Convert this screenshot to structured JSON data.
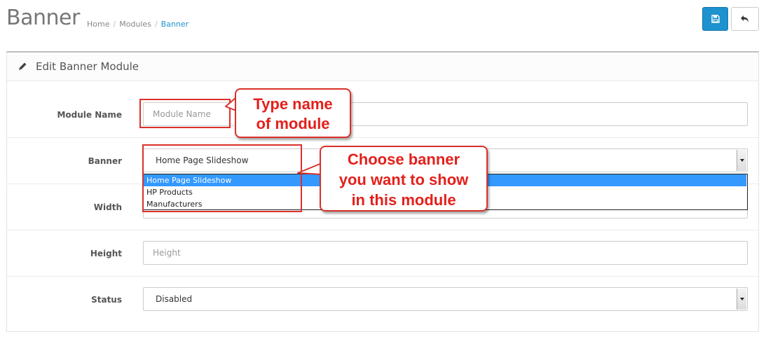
{
  "header": {
    "title": "Banner",
    "breadcrumb": [
      "Home",
      "Modules",
      "Banner"
    ],
    "save_icon": "save-icon",
    "back_icon": "reply-icon",
    "accent_color": "#1e91cf"
  },
  "panel": {
    "heading_icon": "pencil-icon",
    "heading": "Edit Banner Module",
    "fields": {
      "module_name": {
        "label": "Module Name",
        "placeholder": "Module Name"
      },
      "banner": {
        "label": "Banner",
        "value": "Home Page Slideshow",
        "options": [
          "Home Page Slideshow",
          "HP Products",
          "Manufacturers"
        ],
        "selected_index": 0
      },
      "width": {
        "label": "Width"
      },
      "height": {
        "label": "Height",
        "placeholder": "Height"
      },
      "status": {
        "label": "Status",
        "value": "Disabled"
      }
    }
  },
  "annotations": {
    "callout_name": [
      "Type name",
      "of module"
    ],
    "callout_banner": [
      "Choose banner",
      "you want to show",
      "in this module"
    ],
    "annotation_color": "#d9312b"
  }
}
